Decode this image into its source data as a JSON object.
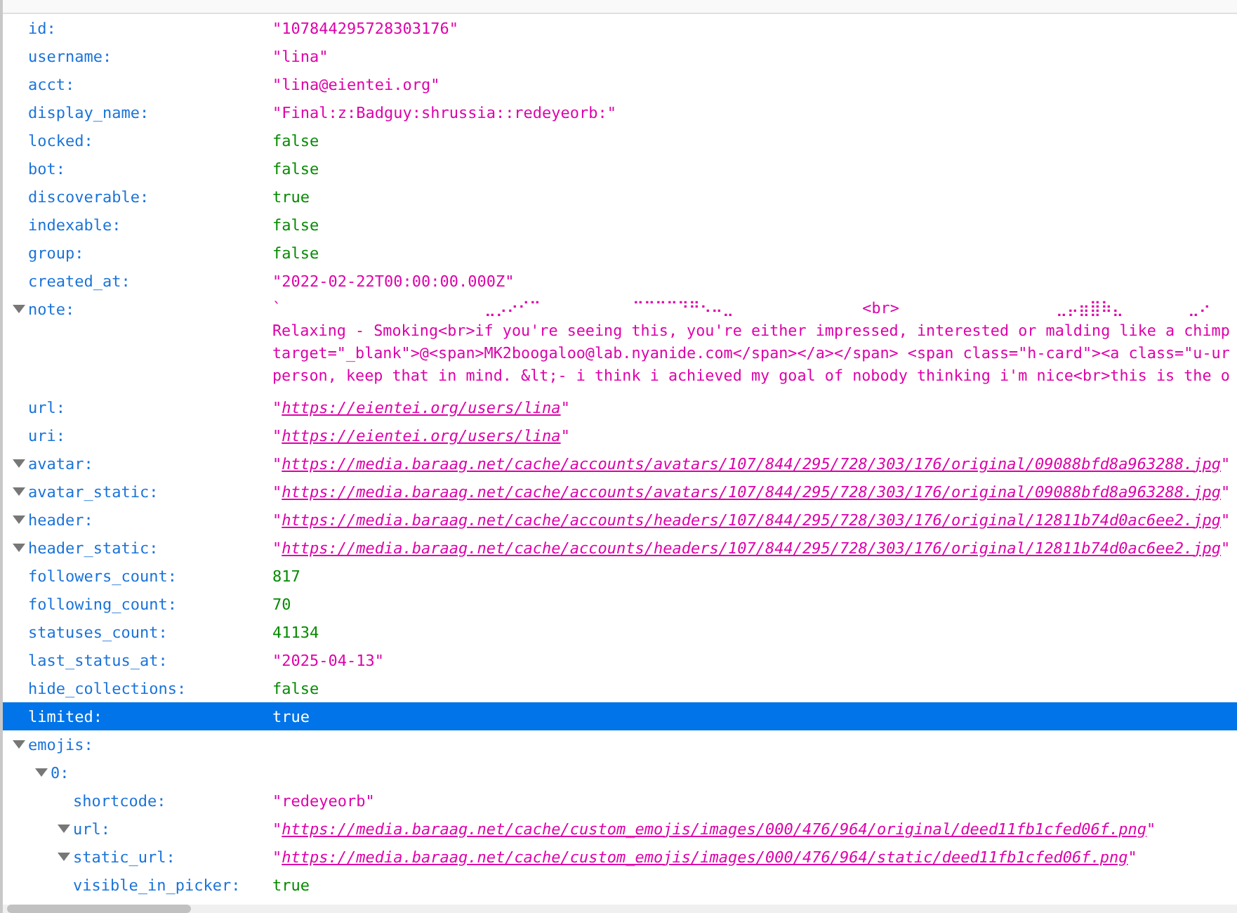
{
  "rows": [
    {
      "key": "id:",
      "value": "\"107844295728303176\"",
      "kind": "string"
    },
    {
      "key": "username:",
      "value": "\"lina\"",
      "kind": "string"
    },
    {
      "key": "acct:",
      "value": "\"lina@eientei.org\"",
      "kind": "string"
    },
    {
      "key": "display_name:",
      "value": "\"Final:z:Badguy:shrussia::redeyeorb:\"",
      "kind": "string"
    },
    {
      "key": "locked:",
      "value": "false",
      "kind": "literal"
    },
    {
      "key": "bot:",
      "value": "false",
      "kind": "literal"
    },
    {
      "key": "discoverable:",
      "value": "true",
      "kind": "literal"
    },
    {
      "key": "indexable:",
      "value": "false",
      "kind": "literal"
    },
    {
      "key": "group:",
      "value": "false",
      "kind": "literal"
    },
    {
      "key": "created_at:",
      "value": "\"2022-02-22T00:00:00.000Z\"",
      "kind": "string"
    },
    {
      "key": "note:",
      "expanded": true,
      "kind": "multiline",
      "lines": [
        "`                      ⣀⡠⠔⠊⠉          ⠉⠉⠉⠉⠙⠛⠢⠤⣀              <br>                 ⣀⡤⣶⣿⠷⣄       ⣀⠔",
        "Relaxing - Smoking<br>if you're seeing this, you're either impressed, interested or malding like a chimp",
        "target=\"_blank\">@<span>MK2boogaloo@lab.nyanide.com</span></a></span> <span class=\"h-card\"><a class=\"u-ur",
        "person, keep that in mind. &lt;- i think i achieved my goal of nobody thinking i'm nice<br>this is the o"
      ]
    },
    {
      "key": "url:",
      "value": "\"https://eientei.org/users/lina\"",
      "kind": "url"
    },
    {
      "key": "uri:",
      "value": "\"https://eientei.org/users/lina\"",
      "kind": "url"
    },
    {
      "key": "avatar:",
      "expanded": true,
      "value": "\"https://media.baraag.net/cache/accounts/avatars/107/844/295/728/303/176/original/09088bfd8a963288.jpg\"",
      "kind": "url"
    },
    {
      "key": "avatar_static:",
      "expanded": true,
      "value": "\"https://media.baraag.net/cache/accounts/avatars/107/844/295/728/303/176/original/09088bfd8a963288.jpg\"",
      "kind": "url"
    },
    {
      "key": "header:",
      "expanded": true,
      "value": "\"https://media.baraag.net/cache/accounts/headers/107/844/295/728/303/176/original/12811b74d0ac6ee2.jpg\"",
      "kind": "url"
    },
    {
      "key": "header_static:",
      "expanded": true,
      "value": "\"https://media.baraag.net/cache/accounts/headers/107/844/295/728/303/176/original/12811b74d0ac6ee2.jpg\"",
      "kind": "url"
    },
    {
      "key": "followers_count:",
      "value": "817",
      "kind": "literal"
    },
    {
      "key": "following_count:",
      "value": "70",
      "kind": "literal"
    },
    {
      "key": "statuses_count:",
      "value": "41134",
      "kind": "literal"
    },
    {
      "key": "last_status_at:",
      "value": "\"2025-04-13\"",
      "kind": "string"
    },
    {
      "key": "hide_collections:",
      "value": "false",
      "kind": "literal"
    },
    {
      "key": "limited:",
      "value": "true",
      "kind": "literal",
      "selected": true
    },
    {
      "key": "emojis:",
      "expanded": true,
      "children": [
        {
          "key": "0:",
          "expanded": true,
          "children": [
            {
              "key": "shortcode:",
              "value": "\"redeyeorb\"",
              "kind": "string"
            },
            {
              "key": "url:",
              "expanded": true,
              "value": "\"https://media.baraag.net/cache/custom_emojis/images/000/476/964/original/deed11fb1cfed06f.png\"",
              "kind": "url"
            },
            {
              "key": "static_url:",
              "expanded": true,
              "value": "\"https://media.baraag.net/cache/custom_emojis/images/000/476/964/static/deed11fb1cfed06f.png\"",
              "kind": "url"
            },
            {
              "key": "visible_in_picker:",
              "value": "true",
              "kind": "literal"
            }
          ]
        }
      ]
    }
  ]
}
